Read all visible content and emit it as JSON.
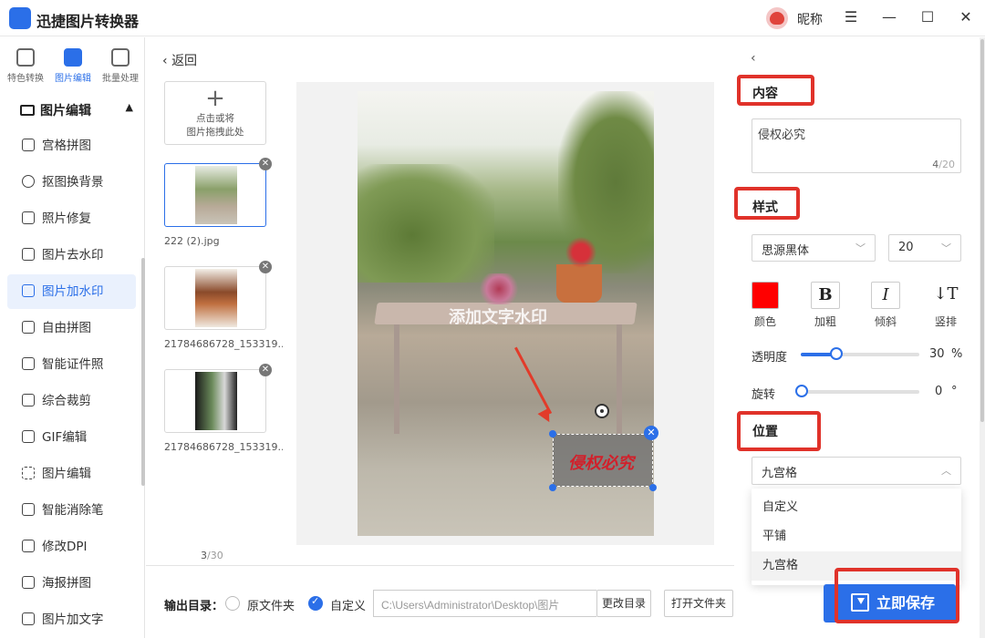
{
  "app": {
    "title": "迅捷图片转换器",
    "nickname": "昵称",
    "accent": "#2b6fe8"
  },
  "window_controls": [
    "menu-icon",
    "minimize-icon",
    "maximize-icon",
    "close-icon"
  ],
  "sidebar": {
    "tabs": [
      {
        "label": "特色转换",
        "icon": "convert-icon"
      },
      {
        "label": "图片编辑",
        "icon": "image-edit-icon",
        "active": true
      },
      {
        "label": "批量处理",
        "icon": "batch-icon"
      }
    ],
    "section": "图片编辑",
    "items": [
      {
        "label": "宫格拼图",
        "icon": "grid-icon"
      },
      {
        "label": "抠图换背景",
        "icon": "cutout-icon"
      },
      {
        "label": "照片修复",
        "icon": "repair-icon"
      },
      {
        "label": "图片去水印",
        "icon": "remove-watermark-icon"
      },
      {
        "label": "图片加水印",
        "icon": "add-watermark-icon",
        "active": true
      },
      {
        "label": "自由拼图",
        "icon": "collage-icon"
      },
      {
        "label": "智能证件照",
        "icon": "id-photo-icon"
      },
      {
        "label": "综合裁剪",
        "icon": "crop-icon"
      },
      {
        "label": "GIF编辑",
        "icon": "gif-icon"
      },
      {
        "label": "图片编辑",
        "icon": "edit-icon"
      },
      {
        "label": "智能消除笔",
        "icon": "eraser-pen-icon"
      },
      {
        "label": "修改DPI",
        "icon": "dpi-icon"
      },
      {
        "label": "海报拼图",
        "icon": "poster-icon"
      },
      {
        "label": "图片加文字",
        "icon": "text-icon"
      }
    ]
  },
  "files": {
    "back_label": "返回",
    "add_line1": "点击或将",
    "add_line2": "图片拖拽此处",
    "items": [
      {
        "name": "222 (2).jpg",
        "selected": true
      },
      {
        "name": "21784686728_153319..."
      },
      {
        "name": "21784686728_153319..."
      }
    ],
    "counter_current": "3",
    "counter_total": "/30"
  },
  "preview": {
    "watermark_preset": "添加文字水印",
    "watermark_text": "侵权必究",
    "watermark_color": "#d21f2a"
  },
  "output": {
    "label": "输出目录：",
    "option_original": "原文件夹",
    "option_custom": "自定义",
    "path": "C:\\Users\\Administrator\\Desktop\\图片",
    "change_dir": "更改目录",
    "open_folder": "打开文件夹"
  },
  "panel": {
    "content_header": "内容",
    "content_value": "侵权必究",
    "char_count": "4",
    "char_max": "/20",
    "style_header": "样式",
    "font": "思源黑体",
    "font_size": "20",
    "color_label": "颜色",
    "color_value": "#ff0000",
    "bold_label": "加粗",
    "italic_label": "倾斜",
    "vertical_label": "竖排",
    "opacity_label": "透明度",
    "opacity_value": "30",
    "opacity_unit": "%",
    "rotate_label": "旋转",
    "rotate_value": "0",
    "rotate_unit": "°",
    "position_header": "位置",
    "position_value": "九宫格",
    "position_options": [
      "自定义",
      "平铺",
      "九宫格"
    ],
    "save_label": "立即保存"
  }
}
